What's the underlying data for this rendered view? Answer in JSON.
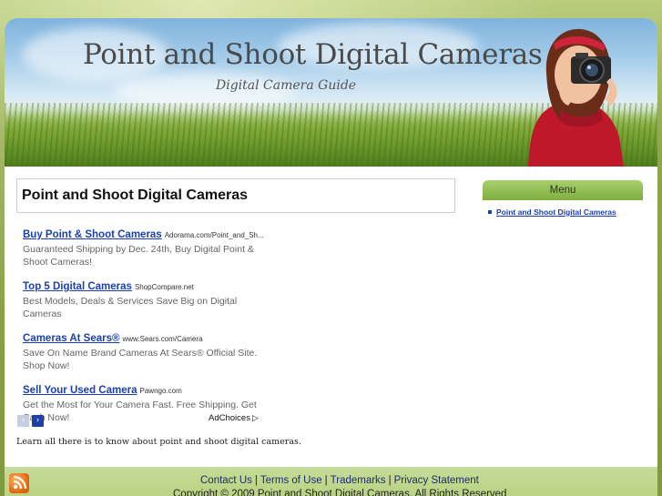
{
  "header": {
    "site_title": "Point and Shoot Digital Cameras",
    "tagline": "Digital Camera Guide"
  },
  "post": {
    "title": "Point and Shoot Digital Cameras",
    "intro": "Learn all there is to know about point and shoot digital cameras."
  },
  "ads": [
    {
      "title": "Buy Point & Shoot Cameras",
      "url": "Adorama.com/Point_and_Sh...",
      "desc": "Guaranteed Shipping by Dec. 24th, Buy Digital Point & Shoot Cameras!"
    },
    {
      "title": "Top 5 Digital Cameras",
      "url": "ShopCompare.net",
      "desc": "Best Models, Deals & Services Save Big on Digital Cameras"
    },
    {
      "title": "Cameras At Sears®",
      "url": "www.Sears.com/Camera",
      "desc": "Save On Name Brand Cameras At Sears® Official Site. Shop Now!"
    },
    {
      "title": "Sell Your Used Camera",
      "url": "Pawngo.com",
      "desc": "Get the Most for Your Camera Fast. Free Shipping. Get Cash Now!"
    }
  ],
  "ad_nav": {
    "prev": "‹",
    "next": "›",
    "adchoices": "AdChoices",
    "adchoices_icon": "▷"
  },
  "sidebar": {
    "menu_title": "Menu",
    "items": [
      {
        "label": "Point and Shoot Digital Cameras"
      }
    ]
  },
  "footer": {
    "links": [
      "Contact Us",
      "Terms of Use",
      "Trademarks",
      "Privacy Statement"
    ],
    "separator": "|",
    "copyright": "Copyright © 2009 Point and Shoot Digital Cameras. All Rights Reserved"
  },
  "icons": {
    "rss": "rss-icon",
    "prev": "chevron-left-icon",
    "next": "chevron-right-icon",
    "adchoices": "adchoices-icon"
  },
  "colors": {
    "link": "#1a3fb0",
    "menu_header": "#8fbb4f",
    "footer_bg": "#c1d88f"
  }
}
